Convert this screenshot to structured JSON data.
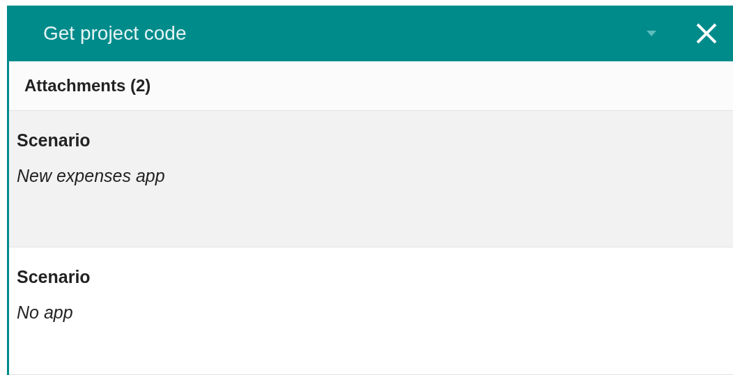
{
  "panel": {
    "title": "Get project code"
  },
  "attachments": {
    "heading": "Attachments (2)",
    "items": [
      {
        "title": "Scenario",
        "subtitle": "New expenses app",
        "selected": true
      },
      {
        "title": "Scenario",
        "subtitle": "No app",
        "selected": false
      }
    ]
  }
}
